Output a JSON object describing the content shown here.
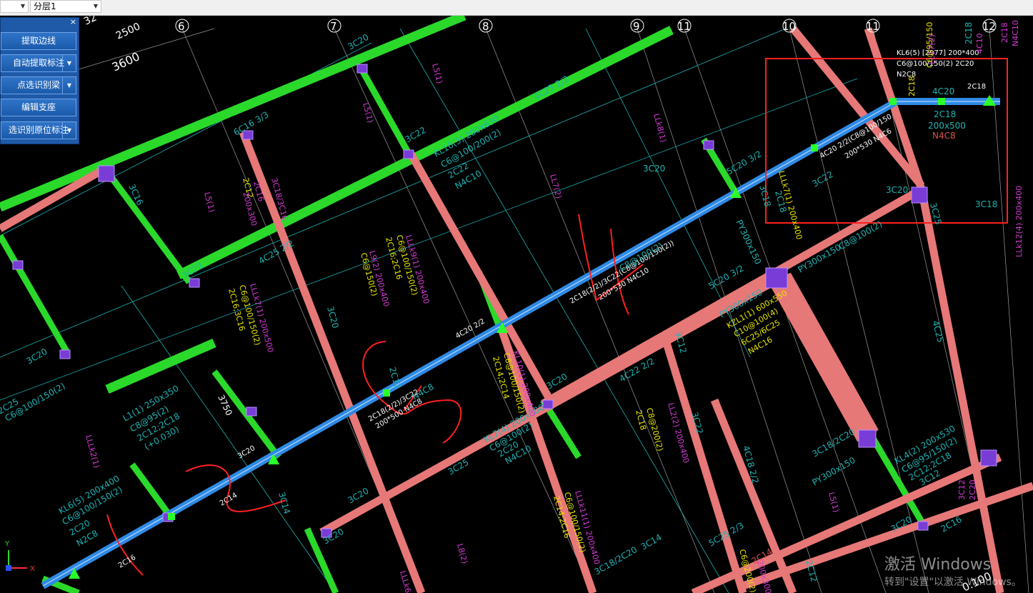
{
  "toolbar": {
    "combo1_value": "",
    "layer_value": "分层1"
  },
  "panel": {
    "close_label": "×",
    "buttons": {
      "b1": "提取边线",
      "b2": "自动提取标注",
      "b3": "点选识别梁",
      "b4": "编辑支座",
      "b5": "选识别原位标注"
    }
  },
  "grid_axes": [
    "6",
    "7",
    "8",
    "9",
    "11",
    "10",
    "11",
    "12"
  ],
  "dimensions": {
    "d2500": "2500",
    "d3600": "3600",
    "d3750": "3750",
    "d32": "32",
    "d100": "0.100"
  },
  "labels": {
    "kl6_top": "KL6(5) [2977] 200*400",
    "kl6_top2": "C6@100/150(2) 2C20",
    "kl6_top3": "N2C8",
    "c4c20": "4C20",
    "c2c18a": "2C18",
    "c2c18b": "2C18",
    "s200x500": "200x500",
    "n4c8": "N4C8",
    "beam_blue1": "4C20 2/2(C8@100/150",
    "beam_blue2": "200*530 N4C6",
    "k3c20": "3C20",
    "k3c25": "3C25",
    "k3c18": "3C18",
    "k5c20": "5C20 3/2",
    "py300x150a": "PY300x150",
    "py300x150b": "PY300x150",
    "py300x150c": "PY300x150",
    "py300x150d": "PY300x150",
    "k3c18c": "3C18",
    "c8100": "C8@100(2)",
    "lllk7": "LLLk7(1) 200x400",
    "c8100b": "C8@100(2)",
    "mid_note1": "2C18(2/2)/3C22(C8@100/150(2))",
    "mid_note2": "200*530 N4C10",
    "c5c20": "5C20 3/2",
    "c3c12": "3C12",
    "c4c22": "4C22 2/2",
    "c8100c": "C8@100(2)",
    "kzl1": "KZL1(1) 600x550",
    "c10100": "C10@100(4)",
    "c6c25": "6C25/6C25",
    "n4c16": "N4C16",
    "c2c18d": "2C18",
    "c3c22": "3C22",
    "c4c18": "4C18 2/2",
    "ll2": "LL2(2) 200x400",
    "c8200": "C8@200(2)",
    "c3c18_2c20": "3C18/2C20",
    "kl4": "KL4(2) 200x530",
    "c6_95": "C6@95/150(2)",
    "c2c12": "2C12;2C18",
    "c3c12b": "3C12",
    "c3c12c": "3C12",
    "c4c25": "4C25",
    "lllk12": "LLk12(4) 200x400",
    "c2c16": "2C16",
    "c3c20b": "3C20",
    "c5c25": "5C25 2/3",
    "c6_200": "C6@200(2)",
    "c200x300": "200x300",
    "c2c14": "2C14",
    "c2c12b": "2C12",
    "kl6_bot": "KL6(5) 200x400",
    "kl6_bot2": "C6@100/150(2)",
    "kl6_bot3": "2C20",
    "kl6_bot4": "N2C8",
    "c2c16b": "2C16",
    "c2c14b": "2C14",
    "c3c14": "3C14",
    "c3c20c": "3C20",
    "c3c20d": "3C20",
    "c3c25b": "3C25",
    "c2c20": "2C20",
    "l1": "L1(1) 250x350",
    "l1b": "C8@95(2)",
    "l1c": "2C12;2C18",
    "l1d": "(+0.030)",
    "lllk2": "LLLk2(1)",
    "kl7": "KL7(4) 200x500",
    "kl7b": "C6@100(2)",
    "kl7c": "2C20",
    "kl7d": "N4C10",
    "kl10": "KL10(1) 200x400",
    "kl10b": "C8@100/150(2)",
    "kl10c": "2C14;2C14",
    "beam_mid1": "4C20 2/2",
    "beam_mid2": "2C18(2/2)/3C22",
    "beam_mid3": "200*500 N4C8",
    "n4c8b": "N4C8",
    "c2c12c": "2C12",
    "c3c20e": "3C20",
    "lllk11": "LLLk11(1) 200x400",
    "lllk11b": "C6@100/150(2)",
    "lllk11c": "2C14;2C16",
    "c3c14b": "3C14",
    "c3c18_2c20b": "3C18/2C20",
    "l8": "L8(2)",
    "lllk6": "LLLk6(1)",
    "c3c20f": "3C20",
    "c3c20g": "3C20",
    "kl10_upper": "KL10(3) 200x630",
    "kl10_upper2": "C6@100/200(2)",
    "kl10_upper3": "2C22",
    "kl10_upper4": "N4C10",
    "c3c22b": "3C22",
    "c4c25b": "4C25 2/2",
    "l5": "L5(1)",
    "l5b": "L5(1)",
    "l5c": "L5(1)",
    "l5d": "L5(1)",
    "ll7": "LL7(2)",
    "lllk9": "LLLk9(1) 200x400",
    "lllk9b": "C6@100/150(2)",
    "lllk9c": "2C16;2C16",
    "l9": "L9(2) 200x400",
    "l9b": "C6@150(2)",
    "l9c": "2C18",
    "c3c20h": "3C20",
    "lllk7b": "LLLk7(1) 200x500",
    "lllk7c": "C6@100/150(2)",
    "lllk7d": "2C16;3C16",
    "lllk7e": "N4C10",
    "c4c25c": "4C25 2/2",
    "c3c22c": "3C22",
    "c2c12d": "2C12",
    "c2c16c": "2C16",
    "c200x300b": "200x300",
    "c3c18_3c16": "3C18/3C16",
    "c6c16": "6C16 3/3",
    "c3c16": "3C16",
    "c2c20b": "2C20",
    "c2c25": "2C25",
    "c6_150": "C6@100/150(2)",
    "c3c20i": "3C20",
    "c3c20j": "3C20",
    "llk8": "LLk8(1)",
    "ll17": "LL17(2)",
    "c6_95b": "C6@95/150",
    "c2c18e": "2C18",
    "n4c10": "N4C10",
    "c2c18f": "2C18",
    "c4c10": "4C10",
    "c3c18f": "3C18",
    "n4c10b": "N4C10",
    "c3c22d": "3C22",
    "c2c20c": "2C20",
    "c3c20k": "3C20",
    "c2c18g": "2C18"
  },
  "watermark": {
    "line1": "激活 Windows",
    "line2": "转到\"设置\"以激活 Windows。"
  },
  "colors": {
    "canvas_bg": "#000000",
    "green_beam": "#2bd92b",
    "pink_beam": "#e77878",
    "blue_beam": "#2e8ae6",
    "purple_support": "#7a3cd6",
    "yellow_text": "#e6e600",
    "cyan_text": "#1fb3b3",
    "magenta_text": "#d43ad4",
    "red_annotation": "#ff2020"
  }
}
